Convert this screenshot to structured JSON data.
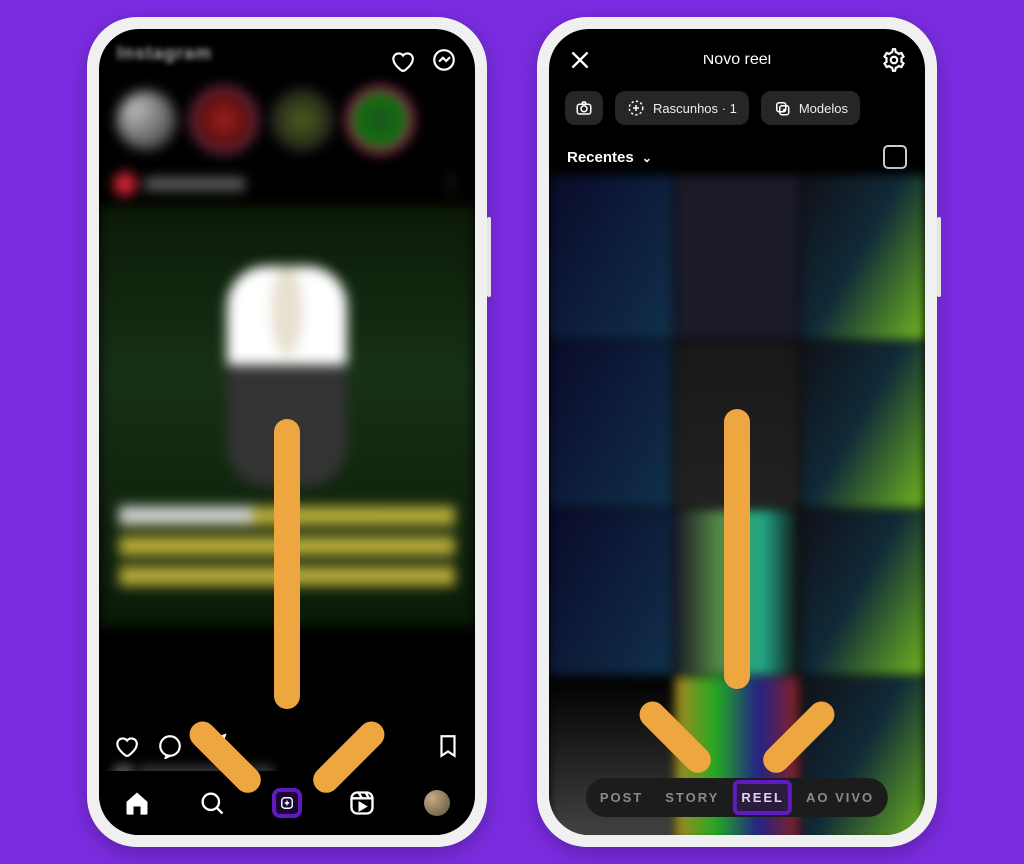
{
  "left_phone": {
    "topbar": {
      "logo_text": "Instagram"
    }
  },
  "right_phone": {
    "header": {
      "title": "Novo reel"
    },
    "chips": {
      "drafts": "Rascunhos · 1",
      "templates": "Modelos"
    },
    "section_label": "Recentes",
    "modes": {
      "post": "POST",
      "story": "STORY",
      "reel": "REEL",
      "live": "AO VIVO"
    }
  },
  "colors": {
    "accent": "#7a2ce0",
    "highlight": "#601ac0",
    "arrow": "#eea640"
  }
}
